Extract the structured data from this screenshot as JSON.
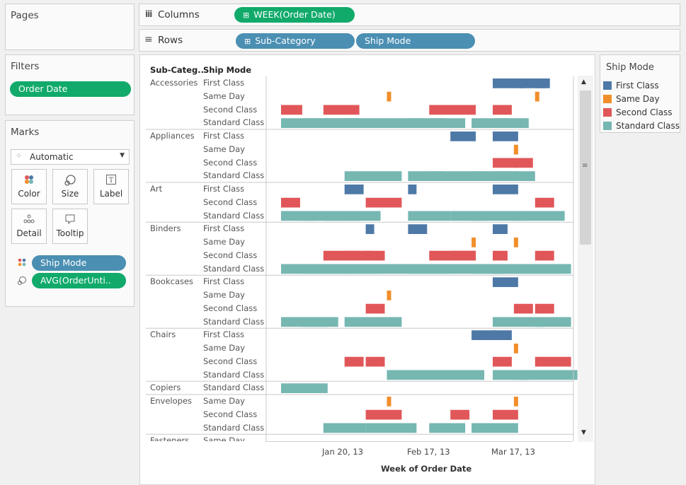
{
  "pages": {
    "title": "Pages"
  },
  "columns": {
    "label": "Columns",
    "pill": "WEEK(Order Date)"
  },
  "rows": {
    "label": "Rows",
    "pills": [
      "Sub-Category",
      "Ship Mode"
    ]
  },
  "filters": {
    "title": "Filters",
    "pill": "Order Date"
  },
  "marks": {
    "title": "Marks",
    "type": "Automatic",
    "buttons": [
      "Color",
      "Size",
      "Label",
      "Detail",
      "Tooltip"
    ],
    "encodings": [
      {
        "icon": "color-icon",
        "label": "Ship Mode",
        "color": "#4b8fb3"
      },
      {
        "icon": "size-icon",
        "label": "AVG(OrderUnti..",
        "color": "#11aa6b"
      }
    ]
  },
  "legend": {
    "title": "Ship Mode",
    "items": [
      {
        "label": "First Class",
        "color": "#4e79a7"
      },
      {
        "label": "Same Day",
        "color": "#f28e2b"
      },
      {
        "label": "Second Class",
        "color": "#e15759"
      },
      {
        "label": "Standard Class",
        "color": "#76b7b2"
      }
    ]
  },
  "view": {
    "header_subcat": "Sub-Categ..",
    "header_shipmode": "Ship Mode",
    "axis_title": "Week of Order Date",
    "axis_ticks": [
      "Jan 20, 13",
      "Feb 17, 13",
      "Mar 17, 13"
    ],
    "truncated_row": {
      "subcat": "Fasteners",
      "mode": "Same Day"
    }
  },
  "chart_data": {
    "type": "gantt",
    "x_field": "WEEK(Order Date)",
    "xlabel": "Week of Order Date",
    "size_field": "AVG(OrderUntilShip)",
    "color_field": "Ship Mode",
    "groups": [
      {
        "subcat": "Accessories",
        "rows": [
          {
            "mode": "First Class",
            "marks": [
              [
                1.0,
                0.15
              ],
              [
                1.12,
                0.15
              ],
              [
                1.2,
                0.05
              ]
            ]
          },
          {
            "mode": "Same Day",
            "marks": [
              [
                0.5,
                0.02
              ],
              [
                1.2,
                0.02
              ]
            ]
          },
          {
            "mode": "Second Class",
            "marks": [
              [
                0.0,
                0.1
              ],
              [
                0.2,
                0.17
              ],
              [
                0.7,
                0.22
              ],
              [
                1.0,
                0.09
              ]
            ]
          },
          {
            "mode": "Standard Class",
            "marks": [
              [
                0.0,
                0.22
              ],
              [
                0.1,
                0.27
              ],
              [
                0.2,
                0.17
              ],
              [
                0.3,
                0.2
              ],
              [
                0.5,
                0.17
              ],
              [
                0.6,
                0.17
              ],
              [
                0.7,
                0.17
              ],
              [
                0.9,
                0.17
              ],
              [
                1.0,
                0.17
              ]
            ]
          }
        ]
      },
      {
        "subcat": "Appliances",
        "rows": [
          {
            "mode": "First Class",
            "marks": [
              [
                0.8,
                0.12
              ],
              [
                1.0,
                0.12
              ]
            ]
          },
          {
            "mode": "Same Day",
            "marks": [
              [
                1.1,
                0.02
              ]
            ]
          },
          {
            "mode": "Second Class",
            "marks": [
              [
                1.0,
                0.12
              ],
              [
                1.1,
                0.09
              ]
            ]
          },
          {
            "mode": "Standard Class",
            "marks": [
              [
                0.3,
                0.27
              ],
              [
                0.6,
                0.17
              ],
              [
                0.7,
                0.27
              ],
              [
                0.9,
                0.22
              ],
              [
                1.0,
                0.2
              ]
            ]
          }
        ]
      },
      {
        "subcat": "Art",
        "rows": [
          {
            "mode": "First Class",
            "marks": [
              [
                0.3,
                0.09
              ],
              [
                0.6,
                0.04
              ],
              [
                1.0,
                0.12
              ]
            ]
          },
          {
            "mode": "Second Class",
            "marks": [
              [
                0.0,
                0.09
              ],
              [
                0.4,
                0.17
              ],
              [
                1.2,
                0.09
              ]
            ]
          },
          {
            "mode": "Standard Class",
            "marks": [
              [
                0.0,
                0.17
              ],
              [
                0.1,
                0.2
              ],
              [
                0.2,
                0.17
              ],
              [
                0.3,
                0.17
              ],
              [
                0.6,
                0.2
              ],
              [
                0.8,
                0.17
              ],
              [
                0.9,
                0.24
              ],
              [
                1.1,
                0.24
              ]
            ]
          }
        ]
      },
      {
        "subcat": "Binders",
        "rows": [
          {
            "mode": "First Class",
            "marks": [
              [
                0.4,
                0.04
              ],
              [
                0.6,
                0.09
              ],
              [
                1.0,
                0.07
              ]
            ]
          },
          {
            "mode": "Same Day",
            "marks": [
              [
                0.9,
                0.02
              ],
              [
                1.1,
                0.02
              ]
            ]
          },
          {
            "mode": "Second Class",
            "marks": [
              [
                0.2,
                0.17
              ],
              [
                0.3,
                0.12
              ],
              [
                0.4,
                0.09
              ],
              [
                0.7,
                0.22
              ],
              [
                0.8,
                0.12
              ],
              [
                1.0,
                0.07
              ],
              [
                1.2,
                0.09
              ]
            ]
          },
          {
            "mode": "Standard Class",
            "marks": [
              [
                0.0,
                0.2
              ],
              [
                0.1,
                0.2
              ],
              [
                0.2,
                0.27
              ],
              [
                0.3,
                0.5
              ],
              [
                0.6,
                0.46
              ],
              [
                0.9,
                0.2
              ],
              [
                1.0,
                0.2
              ],
              [
                1.1,
                0.24
              ],
              [
                1.2,
                0.17
              ]
            ]
          }
        ]
      },
      {
        "subcat": "Bookcases",
        "rows": [
          {
            "mode": "First Class",
            "marks": [
              [
                1.0,
                0.12
              ]
            ]
          },
          {
            "mode": "Same Day",
            "marks": [
              [
                0.5,
                0.02
              ]
            ]
          },
          {
            "mode": "Second Class",
            "marks": [
              [
                0.4,
                0.09
              ],
              [
                1.1,
                0.09
              ],
              [
                1.2,
                0.09
              ]
            ]
          },
          {
            "mode": "Standard Class",
            "marks": [
              [
                0.0,
                0.22
              ],
              [
                0.1,
                0.17
              ],
              [
                0.3,
                0.27
              ],
              [
                1.0,
                0.24
              ],
              [
                1.2,
                0.17
              ]
            ]
          }
        ]
      },
      {
        "subcat": "Chairs",
        "rows": [
          {
            "mode": "First Class",
            "marks": [
              [
                0.9,
                0.12
              ],
              [
                1.0,
                0.09
              ]
            ]
          },
          {
            "mode": "Same Day",
            "marks": [
              [
                1.1,
                0.02
              ]
            ]
          },
          {
            "mode": "Second Class",
            "marks": [
              [
                0.3,
                0.09
              ],
              [
                0.4,
                0.09
              ],
              [
                1.0,
                0.09
              ],
              [
                1.2,
                0.17
              ]
            ]
          },
          {
            "mode": "Standard Class",
            "marks": [
              [
                0.5,
                0.46
              ],
              [
                1.0,
                0.17
              ],
              [
                1.1,
                0.3
              ]
            ]
          }
        ]
      },
      {
        "subcat": "Copiers",
        "rows": [
          {
            "mode": "Standard Class",
            "marks": [
              [
                0.0,
                0.22
              ]
            ]
          }
        ]
      },
      {
        "subcat": "Envelopes",
        "rows": [
          {
            "mode": "Same Day",
            "marks": [
              [
                0.5,
                0.02
              ],
              [
                1.1,
                0.02
              ]
            ]
          },
          {
            "mode": "Second Class",
            "marks": [
              [
                0.4,
                0.17
              ],
              [
                0.8,
                0.09
              ],
              [
                1.0,
                0.12
              ]
            ]
          },
          {
            "mode": "Standard Class",
            "marks": [
              [
                0.2,
                0.2
              ],
              [
                0.4,
                0.24
              ],
              [
                0.7,
                0.17
              ],
              [
                0.9,
                0.22
              ]
            ]
          }
        ]
      }
    ]
  }
}
